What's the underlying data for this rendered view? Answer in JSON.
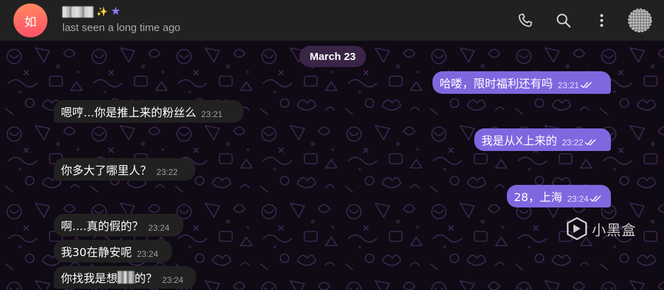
{
  "header": {
    "avatar_initial": "如",
    "name_sparkle": "✨",
    "premium_star": "★",
    "status": "last seen a long time ago",
    "icons": [
      "phone-icon",
      "search-icon",
      "more-vertical-icon",
      "profile-avatar-icon"
    ]
  },
  "chat": {
    "date_label": "March 23",
    "messages": [
      {
        "side": "out",
        "text": "哈喽，限时福利还有吗",
        "time": "23:21",
        "read": true
      },
      {
        "side": "in",
        "text": "嗯哼...你是推上来的粉丝么",
        "time": "23:21"
      },
      {
        "side": "out",
        "text": "我是从X上来的",
        "time": "23:22",
        "read": true
      },
      {
        "side": "in",
        "text": "你多大了哪里人？",
        "time": "23:22"
      },
      {
        "side": "out",
        "text": "28，上海",
        "time": "23:24",
        "read": true
      },
      {
        "side": "in",
        "text": "啊....真的假的？",
        "time": "23:24"
      },
      {
        "side": "in",
        "text": "我30在静安呢",
        "time": "23:24"
      },
      {
        "side": "in",
        "text_before": "你找我是想",
        "text_after": "的？",
        "time": "23:24"
      }
    ]
  },
  "watermark": {
    "text": "小黑盒"
  },
  "colors": {
    "header_bg": "#212121",
    "incoming_bubble": "#212121",
    "outgoing_bubble": "#7f67df",
    "date_pill": "#3a2547",
    "avatar_gradient_top": "#ff885e",
    "avatar_gradient_bottom": "#ff516a"
  }
}
